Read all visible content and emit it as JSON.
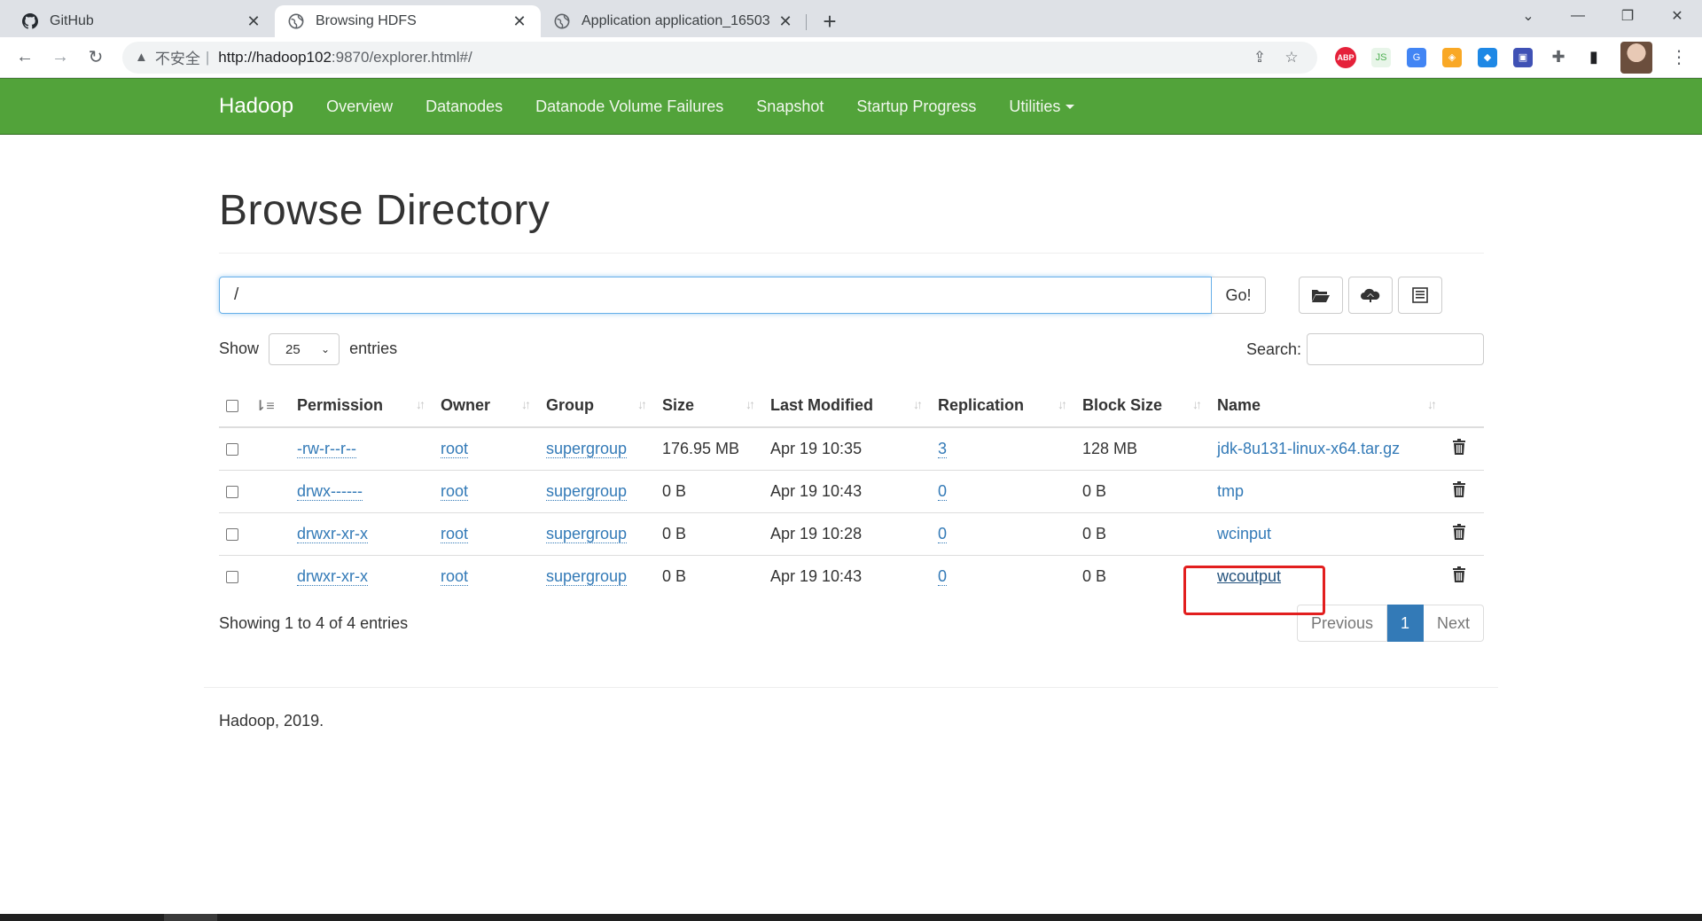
{
  "browser": {
    "tabs": [
      {
        "title": "GitHub",
        "icon": "github-icon"
      },
      {
        "title": "Browsing HDFS",
        "icon": "globe-icon"
      },
      {
        "title": "Application application_16503",
        "icon": "globe-icon"
      }
    ],
    "address": {
      "insecure_label": "不安全",
      "url_host": "http://hadoop102",
      "url_rest": ":9870/explorer.html#/"
    }
  },
  "navbar": {
    "brand": "Hadoop",
    "items": [
      "Overview",
      "Datanodes",
      "Datanode Volume Failures",
      "Snapshot",
      "Startup Progress",
      "Utilities"
    ]
  },
  "page": {
    "title": "Browse Directory",
    "path_value": "/",
    "go_label": "Go!",
    "show_label": "Show",
    "entries_per_page": "25",
    "entries_label": "entries",
    "search_label": "Search:",
    "showing_text": "Showing 1 to 4 of 4 entries",
    "pager": {
      "prev": "Previous",
      "current": "1",
      "next": "Next"
    },
    "footer": "Hadoop, 2019."
  },
  "table": {
    "headers": [
      "Permission",
      "Owner",
      "Group",
      "Size",
      "Last Modified",
      "Replication",
      "Block Size",
      "Name"
    ],
    "rows": [
      {
        "permission": "-rw-r--r--",
        "owner": "root",
        "group": "supergroup",
        "size": "176.95 MB",
        "modified": "Apr 19 10:35",
        "replication": "3",
        "block_size": "128 MB",
        "name": "jdk-8u131-linux-x64.tar.gz"
      },
      {
        "permission": "drwx------",
        "owner": "root",
        "group": "supergroup",
        "size": "0 B",
        "modified": "Apr 19 10:43",
        "replication": "0",
        "block_size": "0 B",
        "name": "tmp"
      },
      {
        "permission": "drwxr-xr-x",
        "owner": "root",
        "group": "supergroup",
        "size": "0 B",
        "modified": "Apr 19 10:28",
        "replication": "0",
        "block_size": "0 B",
        "name": "wcinput"
      },
      {
        "permission": "drwxr-xr-x",
        "owner": "root",
        "group": "supergroup",
        "size": "0 B",
        "modified": "Apr 19 10:43",
        "replication": "0",
        "block_size": "0 B",
        "name": "wcoutput"
      }
    ]
  },
  "colors": {
    "navbar_green": "#52a33a",
    "link_blue": "#337ab7",
    "highlight_red": "#e21e1e"
  }
}
